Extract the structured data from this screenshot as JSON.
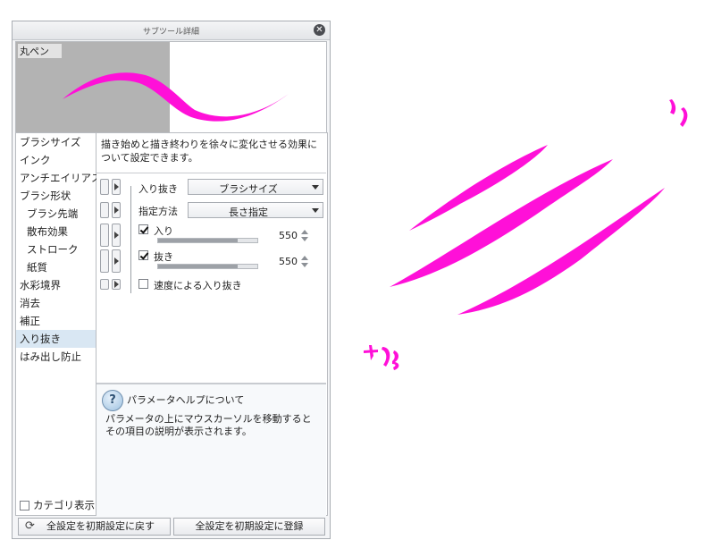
{
  "panel": {
    "title": "サブツール詳細",
    "preview_tool_name": "丸ペン",
    "categories": [
      {
        "label": "ブラシサイズ",
        "sub": false,
        "selected": false
      },
      {
        "label": "インク",
        "sub": false,
        "selected": false
      },
      {
        "label": "アンチエイリアス",
        "sub": false,
        "selected": false
      },
      {
        "label": "ブラシ形状",
        "sub": false,
        "selected": false
      },
      {
        "label": "ブラシ先端",
        "sub": true,
        "selected": false
      },
      {
        "label": "散布効果",
        "sub": true,
        "selected": false
      },
      {
        "label": "ストローク",
        "sub": true,
        "selected": false
      },
      {
        "label": "紙質",
        "sub": true,
        "selected": false
      },
      {
        "label": "水彩境界",
        "sub": false,
        "selected": false
      },
      {
        "label": "消去",
        "sub": false,
        "selected": false
      },
      {
        "label": "補正",
        "sub": false,
        "selected": false
      },
      {
        "label": "入り抜き",
        "sub": false,
        "selected": true
      },
      {
        "label": "はみ出し防止",
        "sub": false,
        "selected": false
      }
    ],
    "category_display_label": "カテゴリ表示",
    "description": "描き始めと描き終わりを徐々に変化させる効果について設定できます。",
    "params": {
      "taper_label": "入り抜き",
      "taper_value": "ブラシサイズ",
      "method_label": "指定方法",
      "method_value": "長さ指定",
      "start_label": "入り",
      "start_value": "550",
      "start_fraction": 0.8,
      "end_label": "抜き",
      "end_value": "550",
      "end_fraction": 0.8,
      "speed_label": "速度による入り抜き"
    },
    "help": {
      "title": "パラメータヘルプについて",
      "text": "パラメータの上にマウスカーソルを移動するとその項目の説明が表示されます。"
    },
    "buttons": {
      "reset_all": "全設定を初期設定に戻す",
      "register_all": "全設定を初期設定に登録"
    }
  },
  "canvas": {
    "stroke_color": "#ff10d8"
  },
  "colors": {
    "stroke": "#ff10d8",
    "selected_category": "#d9e7f3"
  }
}
